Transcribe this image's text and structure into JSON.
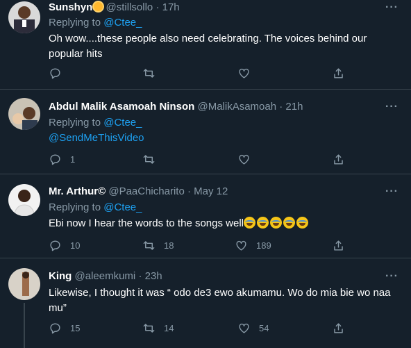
{
  "tweets": [
    {
      "name": "Sunshyn",
      "handle": "@stillsollo",
      "time": "· 17h",
      "replying_label": "Replying to",
      "replying_to": "@Ctee_",
      "lines": [
        "Oh wow....these people also need celebrating. The voices behind our",
        "popular hits"
      ],
      "reply_count": "",
      "retweet_count": "",
      "like_count": ""
    },
    {
      "name": "Abdul Malik Asamoah Ninson",
      "handle": "@MalikAsamoah",
      "time": "· 21h",
      "replying_label": "Replying to",
      "replying_to": "@Ctee_",
      "lines": [
        "@SendMeThisVideo"
      ],
      "reply_count": "1",
      "retweet_count": "",
      "like_count": ""
    },
    {
      "name": "Mr. Arthur©",
      "handle": "@PaaChicharito",
      "time": "· May 12",
      "replying_label": "Replying to",
      "replying_to": "@Ctee_",
      "lines": [
        "Ebi now I hear the words to the songs well"
      ],
      "reply_count": "10",
      "retweet_count": "18",
      "like_count": "189"
    },
    {
      "name": "King",
      "handle": "@aleemkumi",
      "time": "· 23h",
      "lines": [
        "Likewise, I thought it was “ odo de3 ewo akumamu. Wo do mia bie wo naa",
        "mu”"
      ],
      "reply_count": "15",
      "retweet_count": "14",
      "like_count": "54"
    }
  ],
  "more_label": "···",
  "icons": {
    "reply": "reply-icon",
    "retweet": "retweet-icon",
    "like": "heart-icon",
    "share": "share-icon",
    "laughing_emoji": "tears-of-joy-emoji"
  },
  "colors": {
    "background": "#15202b",
    "link": "#1da1f2",
    "muted": "#8899a6",
    "divider": "#38444d",
    "text": "#ffffff"
  }
}
